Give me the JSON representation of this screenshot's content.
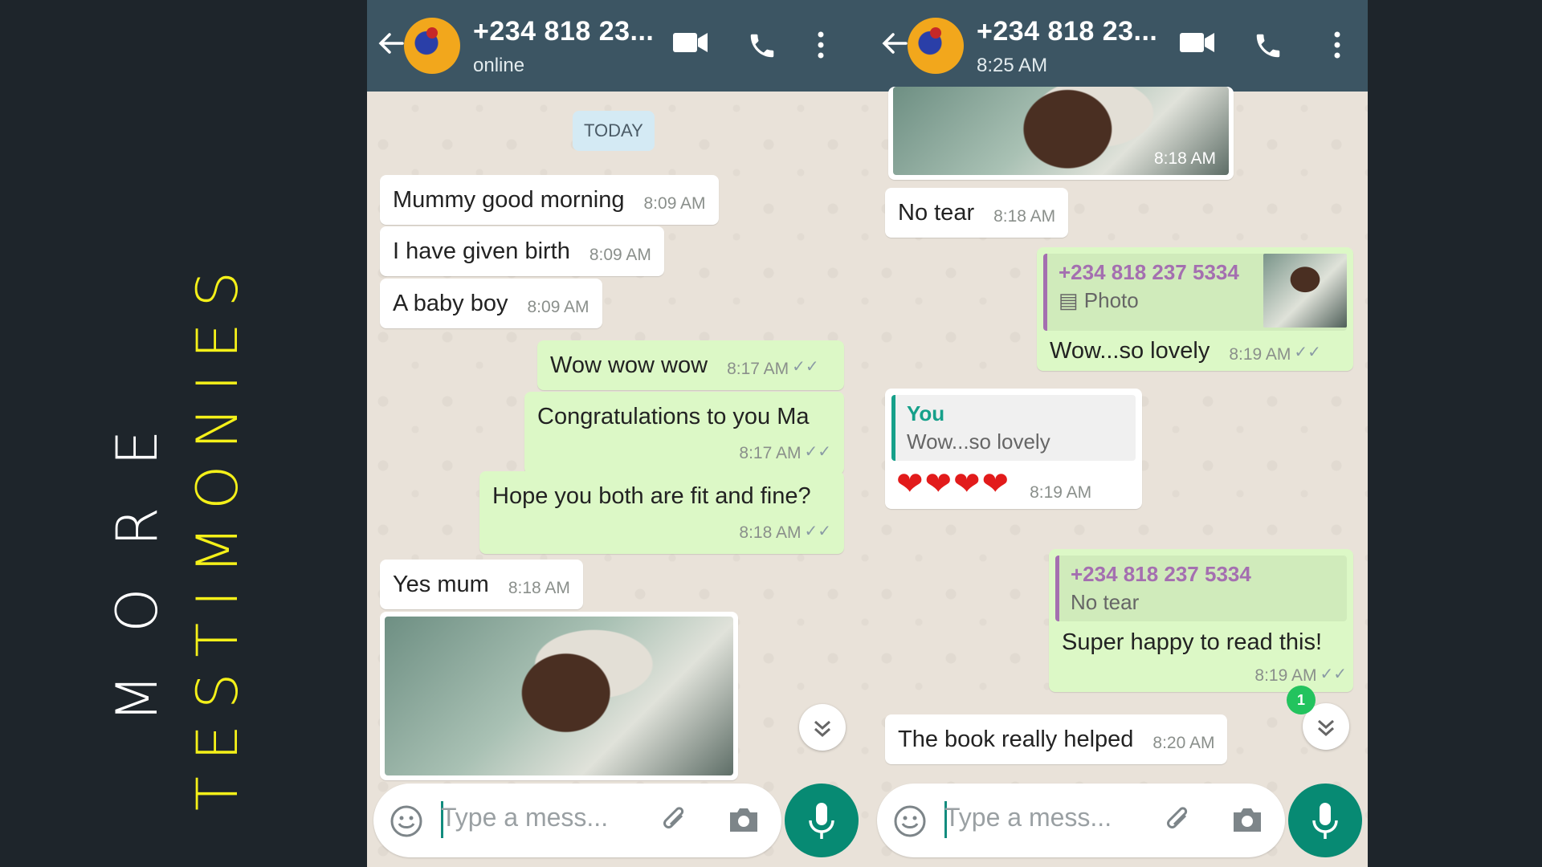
{
  "title": {
    "line1": "MORE",
    "line2": "TESTIMONIES"
  },
  "left_phone": {
    "header": {
      "name": "+234 818 23...",
      "status": "online"
    },
    "date_chip": "TODAY",
    "messages": [
      {
        "dir": "in",
        "text": "Mummy good morning",
        "time": "8:09 AM"
      },
      {
        "dir": "in",
        "text": "I have given birth",
        "time": "8:09 AM"
      },
      {
        "dir": "in",
        "text": "A baby boy",
        "time": "8:09 AM"
      },
      {
        "dir": "out",
        "text": "Wow wow wow",
        "time": "8:17 AM"
      },
      {
        "dir": "out",
        "text": "Congratulations to you Ma",
        "time": "8:17 AM"
      },
      {
        "dir": "out",
        "text": "Hope you both are fit and fine?",
        "time": "8:18 AM"
      },
      {
        "dir": "in",
        "text": "Yes mum",
        "time": "8:18 AM"
      }
    ],
    "input_placeholder": "Type a mess..."
  },
  "right_phone": {
    "header": {
      "name": "+234 818 23...",
      "status": "8:25 AM"
    },
    "photo_time": "8:18 AM",
    "messages": [
      {
        "dir": "in",
        "text": "No tear",
        "time": "8:18 AM"
      },
      {
        "dir": "out",
        "quote_author": "+234 818 237 5334",
        "quote_text": "Photo",
        "text": "Wow...so lovely",
        "time": "8:19 AM"
      },
      {
        "dir": "in",
        "quote_author": "You",
        "quote_text": "Wow...so lovely",
        "text": "❤❤❤❤",
        "time": "8:19 AM"
      },
      {
        "dir": "out",
        "quote_author": "+234 818 237 5334",
        "quote_text": "No tear",
        "text": "Super happy to read this!",
        "time": "8:19 AM"
      },
      {
        "dir": "in",
        "text": "The book really helped",
        "time": "8:20 AM"
      }
    ],
    "unread_count": "1",
    "input_placeholder": "Type a mess..."
  },
  "colors": {
    "background": "#1e252b",
    "title_white": "#ffffff",
    "title_yellow": "#f4f019",
    "header": "#3c5563",
    "outgoing_bubble": "#dcf8c6",
    "mic_button": "#078a73"
  },
  "icons": [
    "back-arrow-icon",
    "video-call-icon",
    "phone-call-icon",
    "more-options-icon",
    "emoji-icon",
    "attach-icon",
    "camera-icon",
    "mic-icon",
    "double-chevron-down-icon",
    "double-check-icon",
    "photo-icon"
  ]
}
